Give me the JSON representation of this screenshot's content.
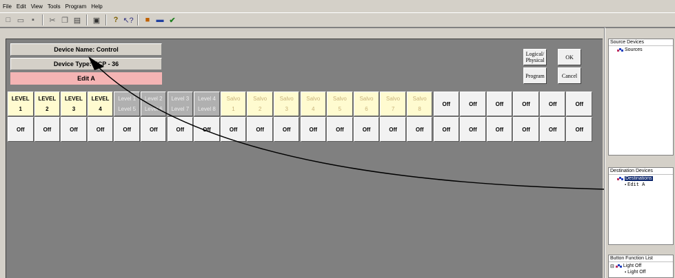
{
  "menu": [
    "File",
    "Edit",
    "View",
    "Tools",
    "Program",
    "Help"
  ],
  "toolbar_icons": [
    "new-icon",
    "open-icon",
    "save-icon",
    "cut-icon",
    "copy-icon",
    "paste-icon",
    "print-icon",
    "help-icon",
    "context-help-icon",
    "source-icon",
    "destination-icon",
    "check-icon"
  ],
  "device": {
    "name": "Device Name: Control",
    "type": "Device Type: UCP - 36",
    "edit": "Edit A"
  },
  "buttons": {
    "logical_physical": "Logical/ Physical",
    "ok": "OK",
    "program": "Program",
    "cancel": "Cancel"
  },
  "grid": {
    "row1": [
      {
        "top": "LEVEL",
        "bottom": "1",
        "kind": "level"
      },
      {
        "top": "LEVEL",
        "bottom": "2",
        "kind": "level"
      },
      {
        "top": "LEVEL",
        "bottom": "3",
        "kind": "level"
      },
      {
        "top": "LEVEL",
        "bottom": "4",
        "kind": "level"
      },
      {
        "top": "Level 1",
        "bottom": "Level 5",
        "kind": "dim"
      },
      {
        "top": "Level 2",
        "bottom": "Level 6",
        "kind": "dim"
      },
      {
        "top": "Level 3",
        "bottom": "Level 7",
        "kind": "dim"
      },
      {
        "top": "Level 4",
        "bottom": "Level 8",
        "kind": "dim"
      },
      {
        "top": "Salvo",
        "bottom": "1",
        "kind": "salvo"
      },
      {
        "top": "Salvo",
        "bottom": "2",
        "kind": "salvo"
      },
      {
        "top": "Salvo",
        "bottom": "3",
        "kind": "salvo"
      },
      {
        "top": "Salvo",
        "bottom": "4",
        "kind": "salvo"
      },
      {
        "top": "Salvo",
        "bottom": "5",
        "kind": "salvo"
      },
      {
        "top": "Salvo",
        "bottom": "6",
        "kind": "salvo"
      },
      {
        "top": "Salvo",
        "bottom": "7",
        "kind": "salvo"
      },
      {
        "top": "Salvo",
        "bottom": "8",
        "kind": "salvo"
      },
      {
        "top": "Off",
        "bottom": "",
        "kind": "off"
      },
      {
        "top": "Off",
        "bottom": "",
        "kind": "off"
      },
      {
        "top": "Off",
        "bottom": "",
        "kind": "off"
      },
      {
        "top": "Off",
        "bottom": "",
        "kind": "off"
      },
      {
        "top": "Off",
        "bottom": "",
        "kind": "off"
      },
      {
        "top": "Off",
        "bottom": "",
        "kind": "off"
      }
    ],
    "row2": [
      "Off",
      "Off",
      "Off",
      "Off",
      "Off",
      "Off",
      "Off",
      "Off",
      "Off",
      "Off",
      "Off",
      "Off",
      "Off",
      "Off",
      "Off",
      "Off",
      "Off",
      "Off",
      "Off",
      "Off",
      "Off",
      "Off"
    ]
  },
  "source_panel": {
    "header": "Source Devices",
    "root": "Sources"
  },
  "dest_panel": {
    "header": "Destination Devices",
    "root": "Destinations",
    "child": "Edit A"
  },
  "func_panel": {
    "header": "Button Function List",
    "root": "Light Off",
    "child": "Light Off"
  },
  "colors": {
    "panel": "#808080",
    "edit_highlight": "#f4b4b4",
    "selection": "#0a246a"
  }
}
